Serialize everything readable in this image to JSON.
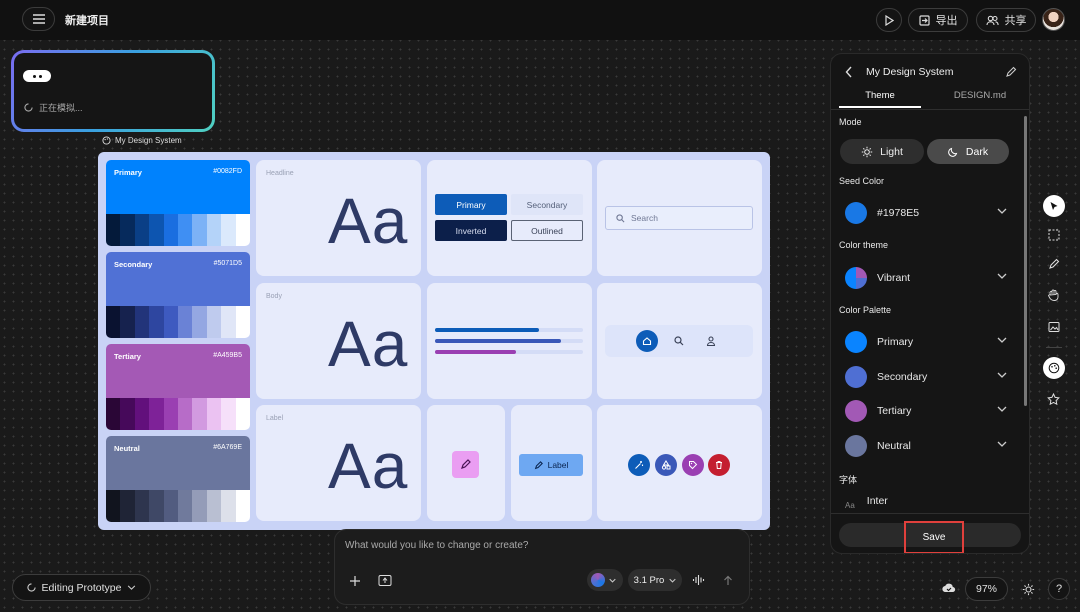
{
  "topbar": {
    "project_title": "新建项目",
    "export_label": "导出",
    "share_label": "共享"
  },
  "sim_panel": {
    "status": "正在模拟..."
  },
  "board": {
    "title": "My Design System",
    "palette_cards": [
      {
        "name": "Primary",
        "hex": "#0082FD",
        "color": "#0082fd",
        "shades": [
          "#041a3a",
          "#062a5c",
          "#0a3f86",
          "#0d55b0",
          "#1a6ee0",
          "#3f8ff3",
          "#7cb2f6",
          "#b4d3f9",
          "#dbe9fc",
          "#ffffff"
        ]
      },
      {
        "name": "Secondary",
        "hex": "#5071D5",
        "color": "#5071d5",
        "shades": [
          "#0a1230",
          "#16224e",
          "#22347a",
          "#2e46a0",
          "#3e5ac0",
          "#6a82d6",
          "#94a7e2",
          "#bfcbee",
          "#e0e6f7",
          "#ffffff"
        ]
      },
      {
        "name": "Tertiary",
        "hex": "#A459B5",
        "color": "#a459b5",
        "shades": [
          "#2a0636",
          "#46095a",
          "#62107c",
          "#7e2298",
          "#9a3fb2",
          "#b76cc8",
          "#d29ae0",
          "#ebc2f2",
          "#f6e0fa",
          "#ffffff"
        ]
      },
      {
        "name": "Neutral",
        "hex": "#6A769E",
        "color": "#6a769e",
        "shades": [
          "#11141e",
          "#1f2436",
          "#2e354e",
          "#3f4866",
          "#525c80",
          "#707a9c",
          "#949cb8",
          "#b9bfd2",
          "#dde0ea",
          "#ffffff"
        ]
      }
    ],
    "type_labels": {
      "headline": "Headline",
      "body": "Body",
      "label": "Label",
      "sample": "Aa"
    },
    "buttons": {
      "primary": "Primary",
      "secondary": "Secondary",
      "inverted": "Inverted",
      "outlined": "Outlined",
      "chip": "Label"
    },
    "search_placeholder": "Search"
  },
  "right_panel": {
    "title": "My Design System",
    "tabs": [
      "Theme",
      "DESIGN.md"
    ],
    "mode_label": "Mode",
    "mode_light": "Light",
    "mode_dark": "Dark",
    "seed_label": "Seed Color",
    "seed_value": "#1978E5",
    "seed_color": "#1978e5",
    "theme_label": "Color theme",
    "theme_value": "Vibrant",
    "palette_label": "Color Palette",
    "palette": [
      {
        "name": "Primary",
        "color": "#0a84ff"
      },
      {
        "name": "Secondary",
        "color": "#4f6fd3"
      },
      {
        "name": "Tertiary",
        "color": "#a259b5"
      },
      {
        "name": "Neutral",
        "color": "#6a769e"
      }
    ],
    "font_label": "字体",
    "font_value": "Inter",
    "save_label": "Save"
  },
  "chat": {
    "placeholder": "What would you like to change or create?",
    "model": "3.1 Pro"
  },
  "footer": {
    "mode_label": "Editing Prototype",
    "zoom": "97%"
  }
}
